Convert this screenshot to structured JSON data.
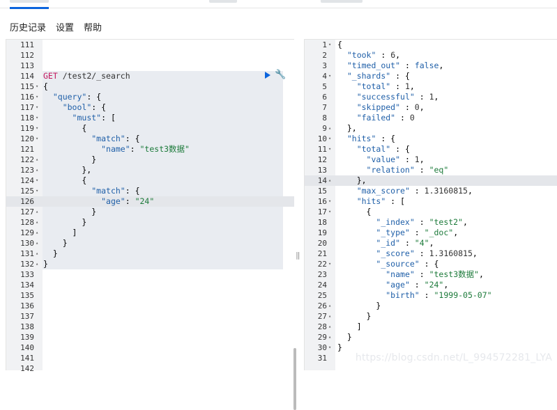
{
  "menu": [
    "历史记录",
    "设置",
    "帮助"
  ],
  "request": {
    "method": "GET",
    "path": "/test2/_search"
  },
  "left_lines": [
    {
      "n": "111",
      "fold": "",
      "code": ""
    },
    {
      "n": "112",
      "fold": "",
      "code": ""
    },
    {
      "n": "113",
      "fold": "",
      "code": ""
    },
    {
      "n": "114",
      "fold": "",
      "code": "__REQ__"
    },
    {
      "n": "115",
      "fold": "▾",
      "code": "{"
    },
    {
      "n": "116",
      "fold": "▾",
      "code": "  \"query\": {"
    },
    {
      "n": "117",
      "fold": "▾",
      "code": "    \"bool\": {"
    },
    {
      "n": "118",
      "fold": "▾",
      "code": "      \"must\": ["
    },
    {
      "n": "119",
      "fold": "▾",
      "code": "        {"
    },
    {
      "n": "120",
      "fold": "▾",
      "code": "          \"match\": {"
    },
    {
      "n": "121",
      "fold": "",
      "code": "            \"name\": \"test3数据\""
    },
    {
      "n": "122",
      "fold": "▴",
      "code": "          }"
    },
    {
      "n": "123",
      "fold": "▴",
      "code": "        },"
    },
    {
      "n": "124",
      "fold": "▾",
      "code": "        {"
    },
    {
      "n": "125",
      "fold": "▾",
      "code": "          \"match\": {"
    },
    {
      "n": "126",
      "fold": "",
      "code": "            \"age\": \"24\""
    },
    {
      "n": "127",
      "fold": "▴",
      "code": "          }"
    },
    {
      "n": "128",
      "fold": "▴",
      "code": "        }"
    },
    {
      "n": "129",
      "fold": "▴",
      "code": "      ]"
    },
    {
      "n": "130",
      "fold": "▴",
      "code": "    }"
    },
    {
      "n": "131",
      "fold": "▴",
      "code": "  }"
    },
    {
      "n": "132",
      "fold": "▴",
      "code": "}"
    },
    {
      "n": "133",
      "fold": "",
      "code": ""
    },
    {
      "n": "134",
      "fold": "",
      "code": ""
    },
    {
      "n": "135",
      "fold": "",
      "code": ""
    },
    {
      "n": "136",
      "fold": "",
      "code": ""
    },
    {
      "n": "137",
      "fold": "",
      "code": ""
    },
    {
      "n": "138",
      "fold": "",
      "code": ""
    },
    {
      "n": "139",
      "fold": "",
      "code": ""
    },
    {
      "n": "140",
      "fold": "",
      "code": ""
    },
    {
      "n": "141",
      "fold": "",
      "code": ""
    },
    {
      "n": "142",
      "fold": "",
      "code": ""
    }
  ],
  "right_lines": [
    {
      "n": "1",
      "fold": "▾",
      "code": "{"
    },
    {
      "n": "2",
      "fold": "",
      "code": "  \"took\" : 6,"
    },
    {
      "n": "3",
      "fold": "",
      "code": "  \"timed_out\" : false,"
    },
    {
      "n": "4",
      "fold": "▾",
      "code": "  \"_shards\" : {"
    },
    {
      "n": "5",
      "fold": "",
      "code": "    \"total\" : 1,"
    },
    {
      "n": "6",
      "fold": "",
      "code": "    \"successful\" : 1,"
    },
    {
      "n": "7",
      "fold": "",
      "code": "    \"skipped\" : 0,"
    },
    {
      "n": "8",
      "fold": "",
      "code": "    \"failed\" : 0"
    },
    {
      "n": "9",
      "fold": "▴",
      "code": "  },"
    },
    {
      "n": "10",
      "fold": "▾",
      "code": "  \"hits\" : {"
    },
    {
      "n": "11",
      "fold": "▾",
      "code": "    \"total\" : {"
    },
    {
      "n": "12",
      "fold": "",
      "code": "      \"value\" : 1,"
    },
    {
      "n": "13",
      "fold": "",
      "code": "      \"relation\" : \"eq\""
    },
    {
      "n": "14",
      "fold": "▴",
      "code": "    },"
    },
    {
      "n": "15",
      "fold": "",
      "code": "    \"max_score\" : 1.3160815,"
    },
    {
      "n": "16",
      "fold": "▾",
      "code": "    \"hits\" : ["
    },
    {
      "n": "17",
      "fold": "▾",
      "code": "      {"
    },
    {
      "n": "18",
      "fold": "",
      "code": "        \"_index\" : \"test2\","
    },
    {
      "n": "19",
      "fold": "",
      "code": "        \"_type\" : \"_doc\","
    },
    {
      "n": "20",
      "fold": "",
      "code": "        \"_id\" : \"4\","
    },
    {
      "n": "21",
      "fold": "",
      "code": "        \"_score\" : 1.3160815,"
    },
    {
      "n": "22",
      "fold": "▾",
      "code": "        \"_source\" : {"
    },
    {
      "n": "23",
      "fold": "",
      "code": "          \"name\" : \"test3数据\","
    },
    {
      "n": "24",
      "fold": "",
      "code": "          \"age\" : \"24\","
    },
    {
      "n": "25",
      "fold": "",
      "code": "          \"birth\" : \"1999-05-07\""
    },
    {
      "n": "26",
      "fold": "▴",
      "code": "        }"
    },
    {
      "n": "27",
      "fold": "▴",
      "code": "      }"
    },
    {
      "n": "28",
      "fold": "▴",
      "code": "    ]"
    },
    {
      "n": "29",
      "fold": "▴",
      "code": "  }"
    },
    {
      "n": "30",
      "fold": "▾",
      "code": "}"
    },
    {
      "n": "31",
      "fold": "",
      "code": ""
    }
  ],
  "left_highlight_line": "126",
  "right_highlight_line": "14",
  "watermark": "https://blog.csdn.net/L_994572281_LYA",
  "splitter_glyph": "‖",
  "icons": {
    "run": "play-icon",
    "settings": "wrench-icon"
  },
  "colors": {
    "accent": "#0b64dd",
    "key": "#1f5fa8",
    "string": "#1c7a3a",
    "method": "#c4185e"
  }
}
